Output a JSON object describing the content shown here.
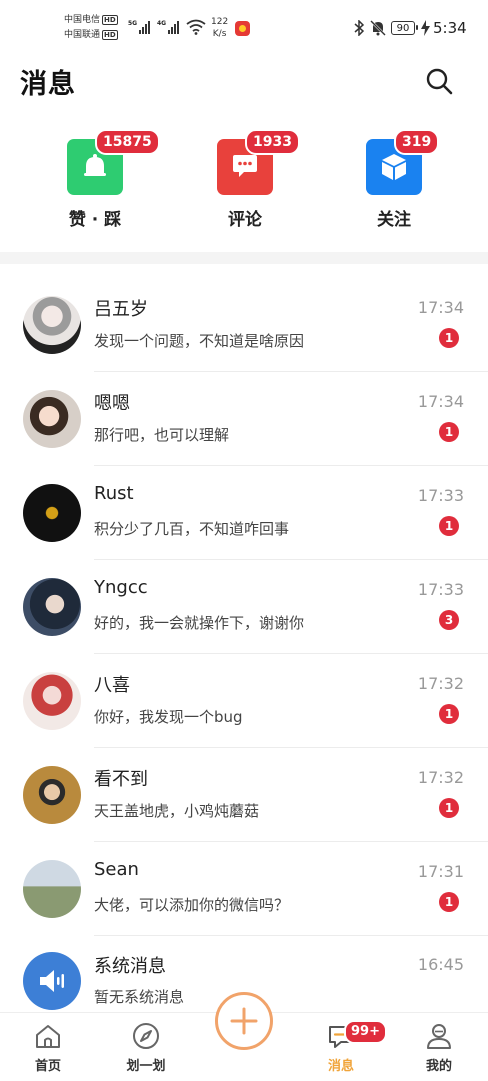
{
  "status_bar": {
    "carrier1": "中国电信",
    "carrier2": "中国联通",
    "hd": "HD",
    "sig1": "5G",
    "sig2": "4G",
    "speed_value": "122",
    "speed_unit": "K/s",
    "battery": "90",
    "time": "5:34"
  },
  "header": {
    "title": "消息"
  },
  "categories": [
    {
      "label": "赞 · 踩",
      "count": "15875",
      "color": "#2ecc71",
      "icon": "bell-icon"
    },
    {
      "label": "评论",
      "count": "1933",
      "color": "#e8413c",
      "icon": "comment-icon"
    },
    {
      "label": "关注",
      "count": "319",
      "color": "#1a82f0",
      "icon": "cube-icon"
    }
  ],
  "messages": [
    {
      "name": "吕五岁",
      "preview": "发现一个问题，不知道是啥原因",
      "time": "17:34",
      "unread": "1"
    },
    {
      "name": "嗯嗯",
      "preview": "那行吧，也可以理解",
      "time": "17:34",
      "unread": "1"
    },
    {
      "name": "Rust",
      "preview": "积分少了几百，不知道咋回事",
      "time": "17:33",
      "unread": "1"
    },
    {
      "name": "Yngcc",
      "preview": "好的，我一会就操作下，谢谢你",
      "time": "17:33",
      "unread": "3"
    },
    {
      "name": "八喜",
      "preview": "你好，我发现一个bug",
      "time": "17:32",
      "unread": "1"
    },
    {
      "name": "看不到",
      "preview": "天王盖地虎，小鸡炖蘑菇",
      "time": "17:32",
      "unread": "1"
    },
    {
      "name": "Sean",
      "preview": "大佬，可以添加你的微信吗？",
      "time": "17:31",
      "unread": "1"
    },
    {
      "name": "系统消息",
      "preview": "暂无系统消息",
      "time": "16:45",
      "unread": ""
    }
  ],
  "nav": {
    "home": "首页",
    "discover": "划一划",
    "messages": "消息",
    "messages_badge": "99+",
    "mine": "我的"
  },
  "colors": {
    "accent": "#f0a43a",
    "badge": "#e02d3c"
  }
}
